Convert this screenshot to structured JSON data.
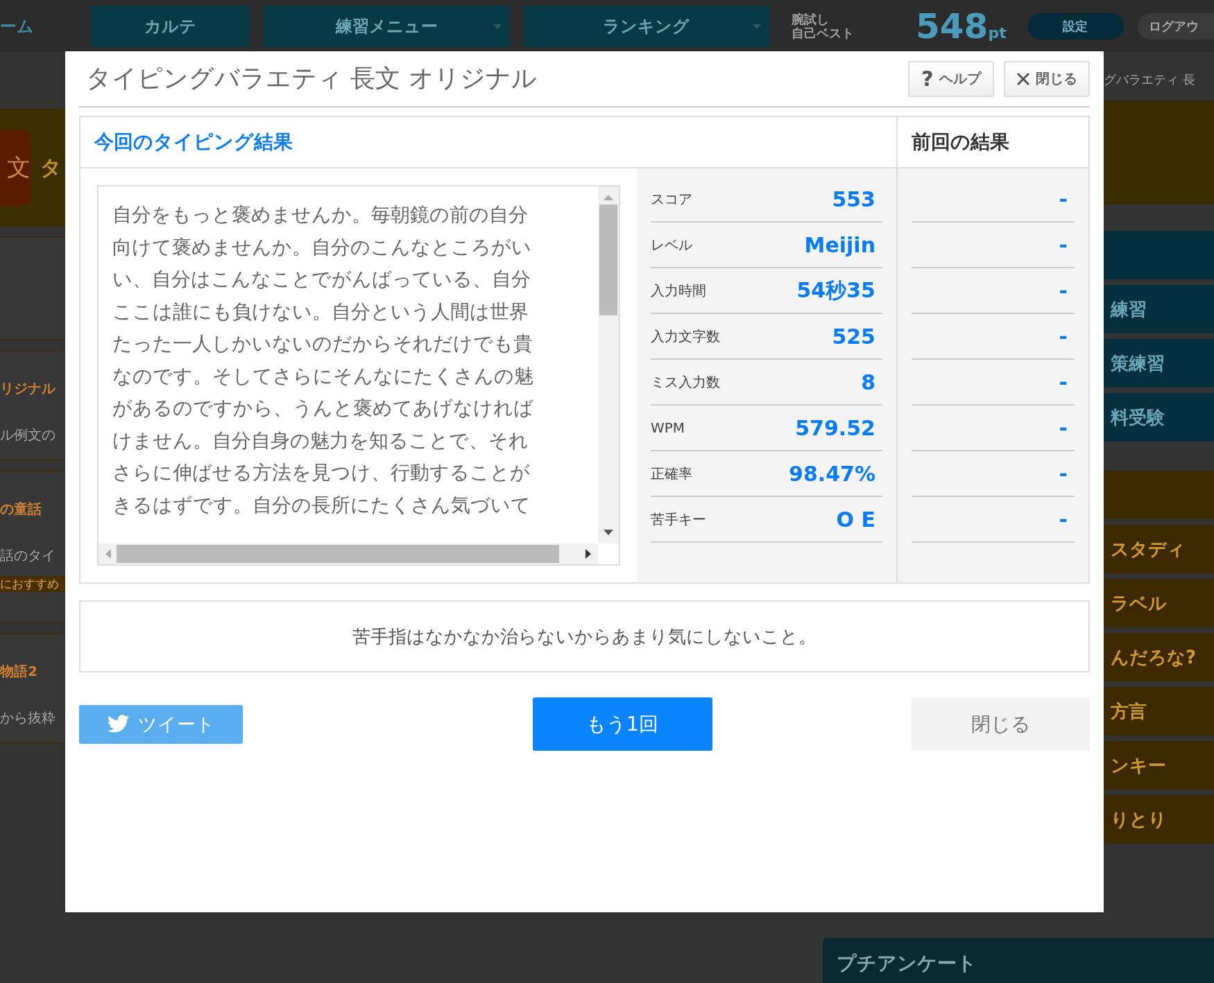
{
  "top_bar": {
    "home_fragment": "ーム",
    "nav": [
      {
        "label": "カルテ",
        "dropdown": false
      },
      {
        "label": "練習メニュー",
        "dropdown": true
      },
      {
        "label": "ランキング",
        "dropdown": true
      }
    ],
    "best_label": [
      "腕試し",
      "自己ベスト"
    ],
    "best_score": "548",
    "best_unit": "pt",
    "settings": "設定",
    "logout_fragment": "ログアウ"
  },
  "left_column": {
    "banner_icon": "文",
    "banner_fragment": "タ",
    "cards": [
      {
        "title": "リジナル",
        "desc": "ル例文の"
      },
      {
        "title": "の童話",
        "desc": "話のタイ",
        "tag": "におすすめ"
      },
      {
        "title": "物語2",
        "desc": "から抜粋"
      }
    ]
  },
  "right_column": {
    "heading_fragment": "グバラエティ 長",
    "teal_items": [
      "練習",
      "策練習",
      "料受験"
    ],
    "orange_items": [
      "スタディ",
      "ラベル",
      "んだろな?",
      "方言",
      "ンキー",
      "りとり"
    ]
  },
  "survey_panel": {
    "title": "プチアンケート"
  },
  "dialog": {
    "title": "タイピングバラエティ 長文 オリジナル",
    "help": {
      "icon": "?",
      "label": "ヘルプ"
    },
    "close_label": "閉じる",
    "current_heading": "今回のタイピング結果",
    "previous_heading": "前回の結果",
    "text_lines": [
      "自分をもっと褒めませんか。毎朝鏡の前の自分",
      "向けて褒めませんか。自分のこんなところがい",
      "い、自分はこんなことでがんばっている、自分",
      "ここは誰にも負けない。自分という人間は世界",
      "たった一人しかいないのだからそれだけでも貴",
      "なのです。そしてさらにそんなにたくさんの魅",
      "があるのですから、うんと褒めてあげなければ",
      "けません。自分自身の魅力を知ることで、それ",
      "さらに伸ばせる方法を見つけ、行動することが",
      "きるはずです。自分の長所にたくさん気づいて"
    ],
    "stats": [
      {
        "label": "スコア",
        "value": "553",
        "previous": "-"
      },
      {
        "label": "レベル",
        "value": "Meijin",
        "previous": "-"
      },
      {
        "label": "入力時間",
        "value": "54秒35",
        "previous": "-"
      },
      {
        "label": "入力文字数",
        "value": "525",
        "previous": "-"
      },
      {
        "label": "ミス入力数",
        "value": "8",
        "previous": "-"
      },
      {
        "label": "WPM",
        "value": "579.52",
        "previous": "-"
      },
      {
        "label": "正確率",
        "value": "98.47%",
        "previous": "-"
      },
      {
        "label": "苦手キー",
        "value": "O E",
        "previous": "-"
      }
    ],
    "advice": "苦手指はなかなか治らないからあまり気にしないこと。",
    "tweet": "ツイート",
    "retry": "もう1回",
    "close_button": "閉じる"
  }
}
